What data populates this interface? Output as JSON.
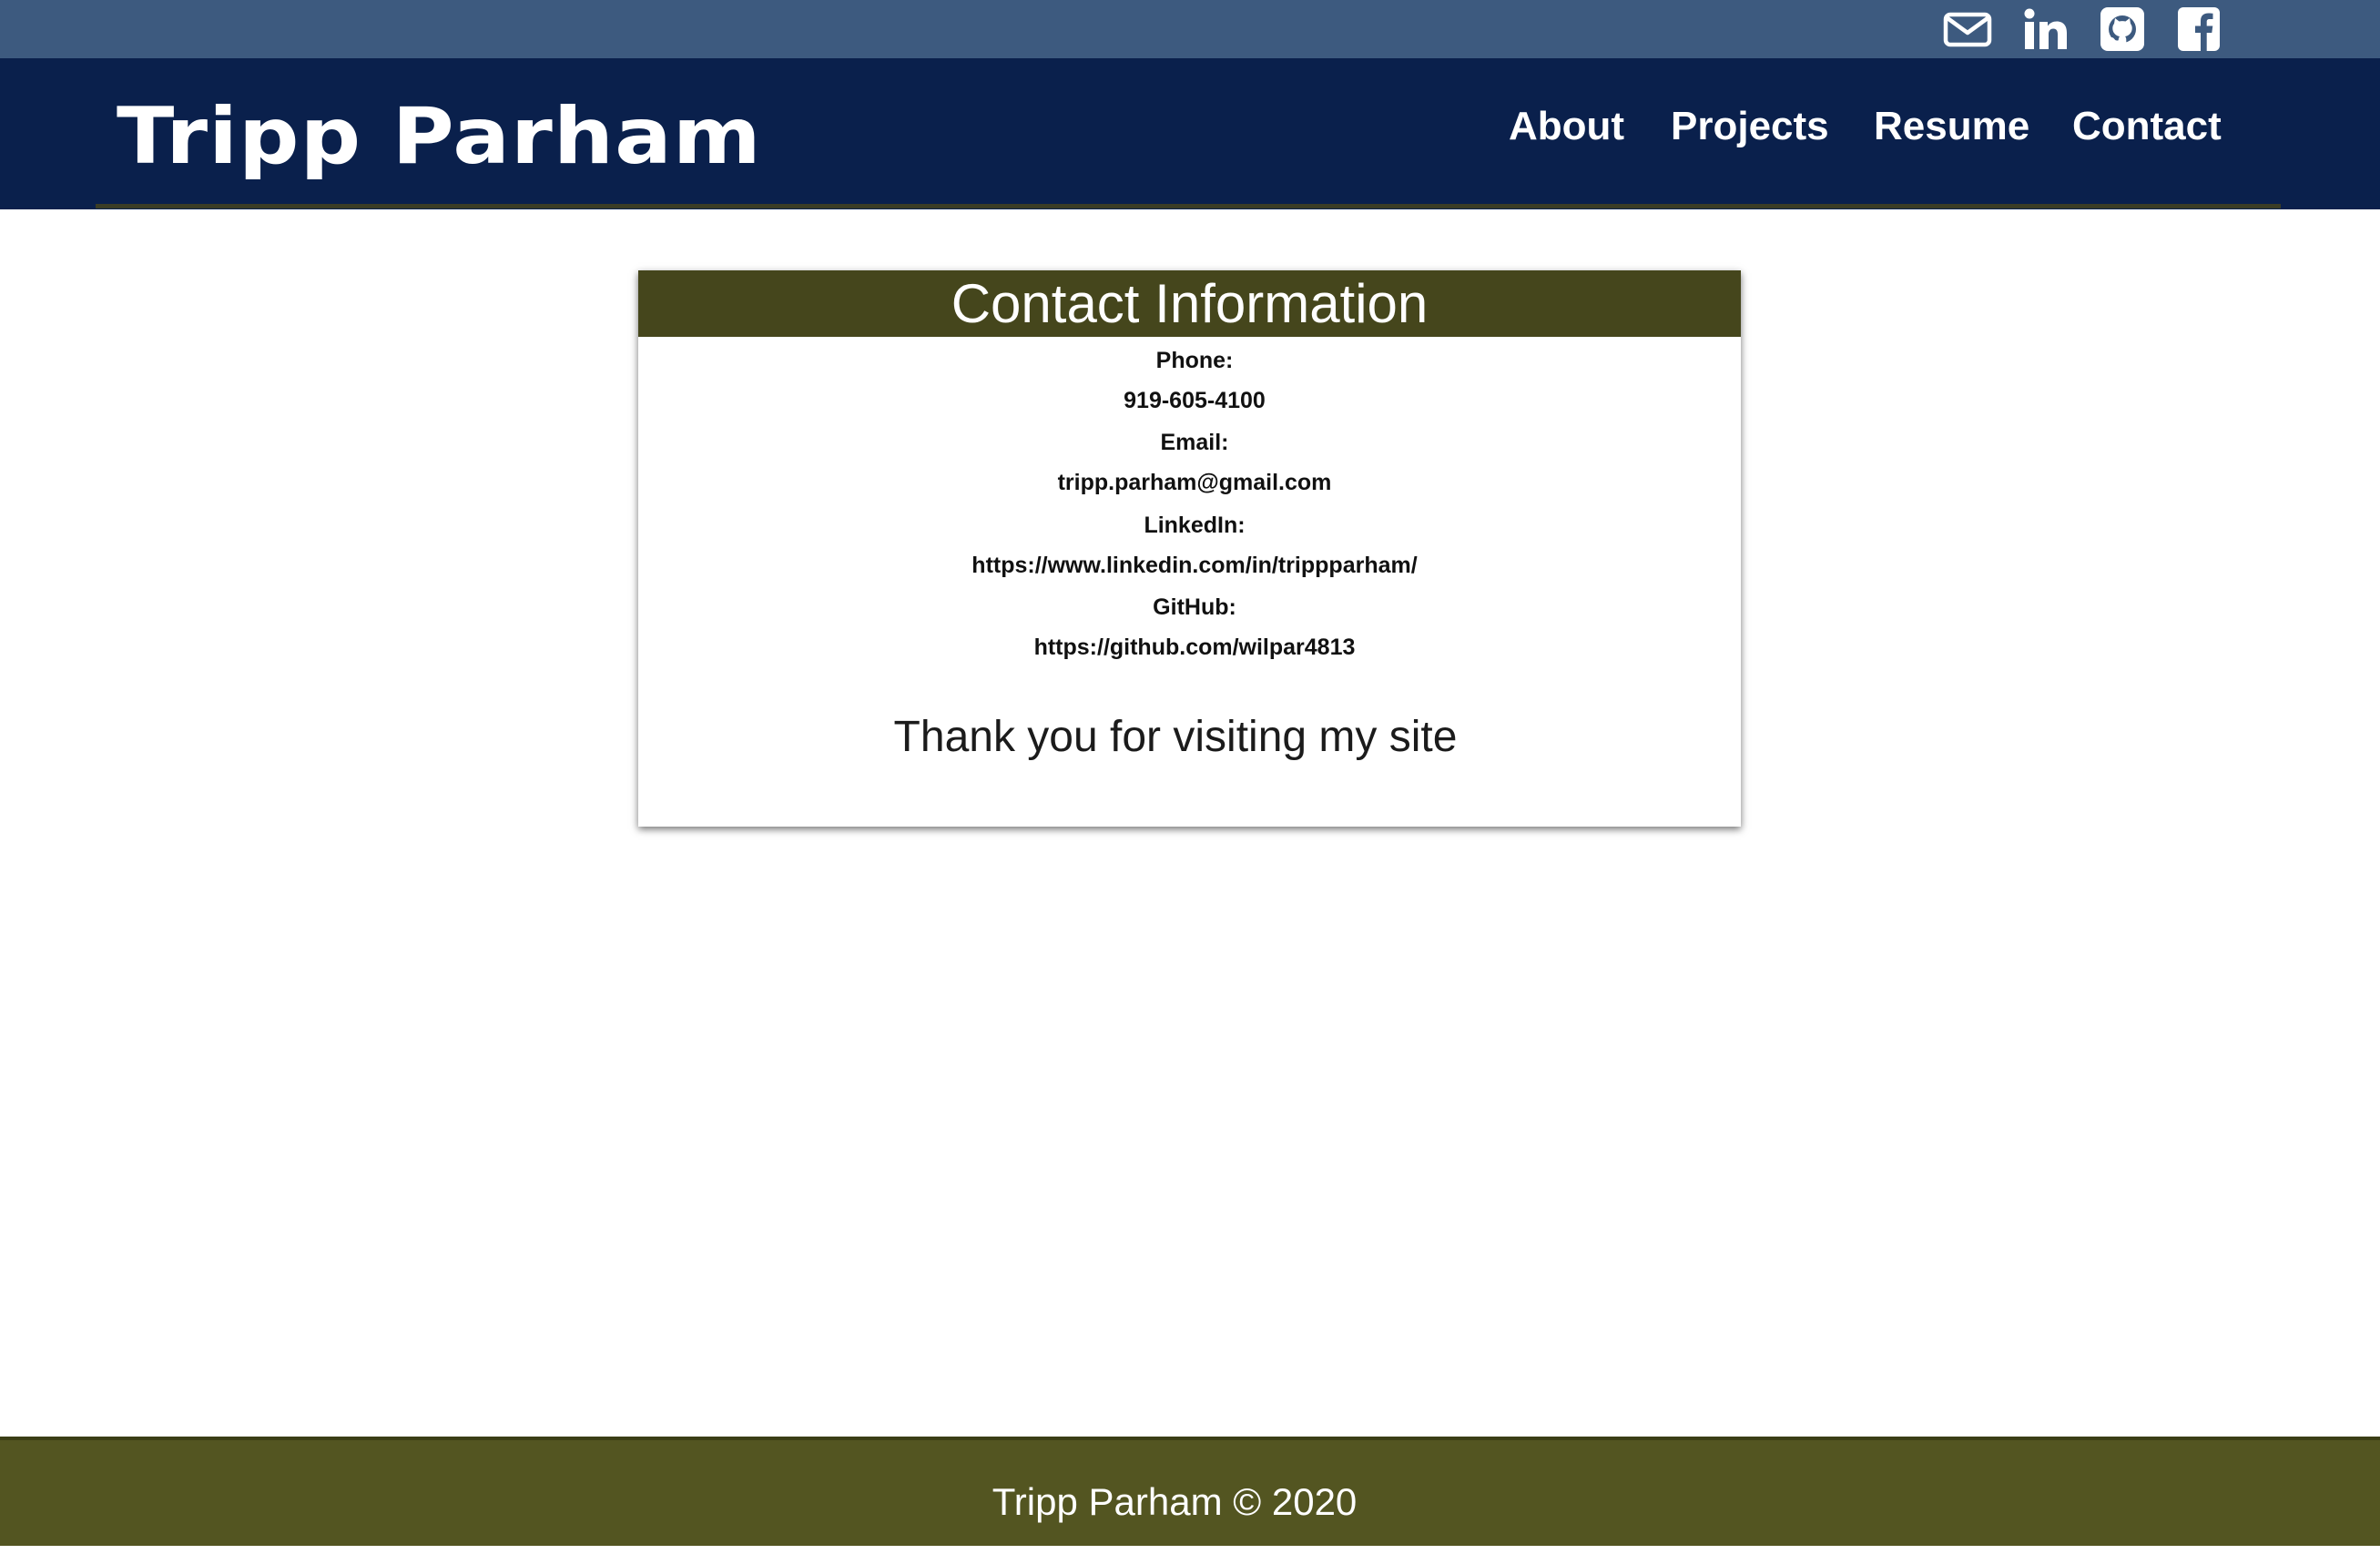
{
  "social": {
    "links": [
      {
        "icon": "envelope-icon"
      },
      {
        "icon": "linkedin-icon"
      },
      {
        "icon": "github-icon"
      },
      {
        "icon": "facebook-icon"
      }
    ]
  },
  "header": {
    "brand": "Tripp Parham",
    "nav": [
      {
        "label": "About"
      },
      {
        "label": "Projects"
      },
      {
        "label": "Resume"
      },
      {
        "label": "Contact"
      }
    ]
  },
  "contact": {
    "title": "Contact Information",
    "phone_label": "Phone:",
    "phone": "919-605-4100",
    "email_label": "Email:",
    "email": "tripp.parham@gmail.com",
    "linkedin_label": "LinkedIn:",
    "linkedin": "https://www.linkedin.com/in/trippparham/",
    "github_label": "GitHub:",
    "github": "https://github.com/wilpar4813",
    "thanks": "Thank you for visiting my site"
  },
  "footer": {
    "text": "Tripp Parham © 2020"
  },
  "colors": {
    "social_bar": "#3d5a7f",
    "nav_bar": "#0a204c",
    "card_header": "#45461c",
    "footer": "#535521"
  }
}
